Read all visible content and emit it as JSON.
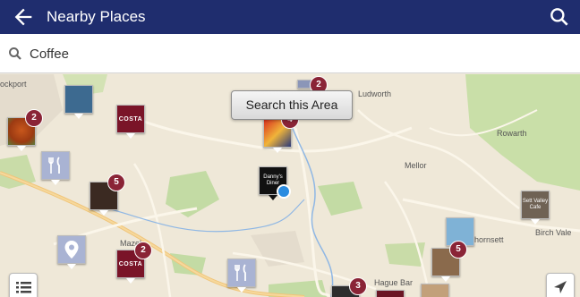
{
  "header": {
    "title": "Nearby Places"
  },
  "search": {
    "value": "Coffee"
  },
  "map": {
    "search_area_label": "Search this Area",
    "labels": {
      "stockport": "ockport",
      "ludworth": "Ludworth",
      "mellor": "Mellor",
      "rowarth": "Rowarth",
      "birch_vale": "Birch Vale",
      "hague_bar": "Hague Bar",
      "thornsett": "hornsett",
      "mazel": "Mazel"
    },
    "pins": {
      "costa_top_label": "COSTA",
      "costa_bottom_label": "COSTA",
      "badge_tree": "2",
      "badge_costa": "2",
      "badge_top": "2",
      "badge_center": "4",
      "badge_left": "5",
      "badge_right": "5",
      "badge_bottom": "3",
      "cafe_text": "Danny's Diner",
      "valley_text": "Sett Valley Cafe"
    }
  }
}
